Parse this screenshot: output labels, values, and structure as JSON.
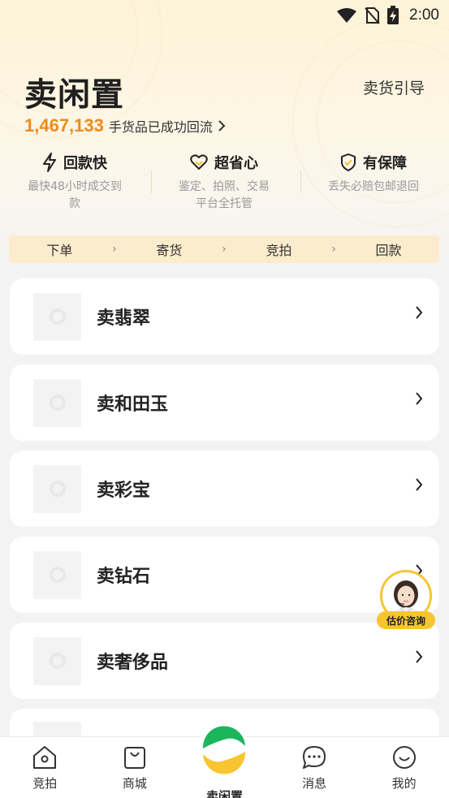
{
  "status_bar": {
    "time": "2:00",
    "icons": [
      "wifi-icon",
      "no-sim-icon",
      "battery-charging-icon"
    ]
  },
  "header": {
    "title": "卖闲置",
    "guide_link": "卖货引导",
    "stats_number": "1,467,133",
    "stats_text": "手货品已成功回流"
  },
  "features": [
    {
      "icon": "lightning-icon",
      "title": "回款快",
      "desc": "最快48小时成交到款"
    },
    {
      "icon": "heart-icon",
      "title": "超省心",
      "desc": "鉴定、拍照、交易平台全托管"
    },
    {
      "icon": "shield-check-icon",
      "title": "有保障",
      "desc": "丢失必赔包邮退回"
    }
  ],
  "steps": [
    "下单",
    "寄货",
    "竞拍",
    "回款"
  ],
  "categories": [
    {
      "label": "卖翡翠"
    },
    {
      "label": "卖和田玉"
    },
    {
      "label": "卖彩宝"
    },
    {
      "label": "卖钻石"
    },
    {
      "label": "卖奢侈品"
    }
  ],
  "consult": {
    "label": "估价咨询"
  },
  "bottom_nav": {
    "items": [
      {
        "label": "竞拍",
        "icon": "house-icon"
      },
      {
        "label": "商城",
        "icon": "shopping-bag-icon"
      },
      {
        "label": "卖闲置",
        "icon": "app-logo-icon"
      },
      {
        "label": "消息",
        "icon": "chat-bubble-icon"
      },
      {
        "label": "我的",
        "icon": "smiley-icon"
      }
    ]
  },
  "colors": {
    "accent_orange": "#f08a1c",
    "accent_yellow": "#f7c531",
    "brand_green": "#1bb55c"
  }
}
